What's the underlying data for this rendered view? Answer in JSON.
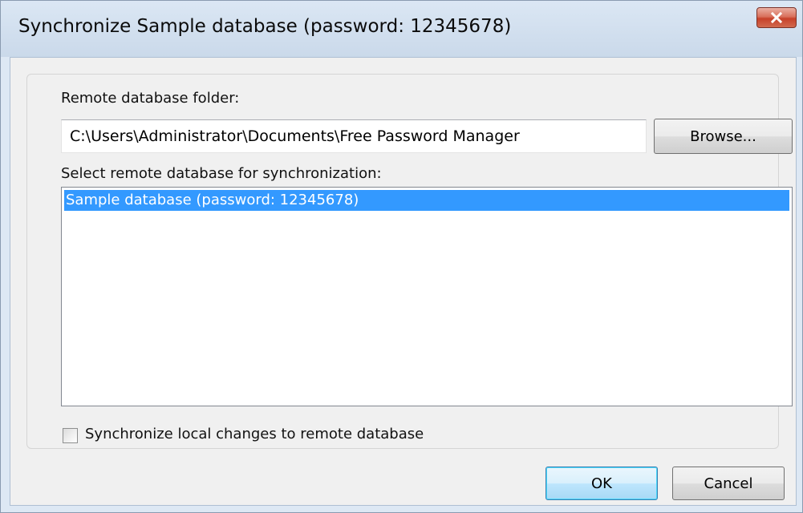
{
  "window": {
    "title": "Synchronize Sample database (password: 12345678)",
    "close_icon": "close-icon"
  },
  "folder": {
    "label": "Remote database folder:",
    "value": "C:\\Users\\Administrator\\Documents\\Free Password Manager",
    "browse_label": "Browse..."
  },
  "database_list": {
    "label": "Select remote database for synchronization:",
    "items": [
      {
        "label": "Sample database (password: 12345678)",
        "selected": true
      }
    ]
  },
  "options": {
    "sync_local_changes_label": "Synchronize local changes to remote database",
    "sync_local_changes_checked": false
  },
  "footer": {
    "ok_label": "OK",
    "cancel_label": "Cancel"
  },
  "colors": {
    "selection": "#3399ff",
    "close_button": "#c7412a",
    "default_button_border": "#3c7fb1"
  }
}
